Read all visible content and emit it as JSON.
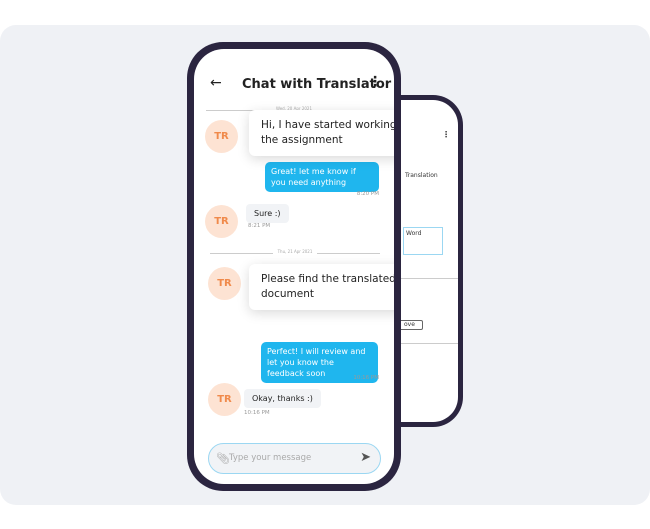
{
  "header": {
    "title": "Chat with Translator"
  },
  "messages": {
    "date1": "Wed, 20 Apr 2021",
    "m1": "Hi, I have started working  on the assignment",
    "m2": "Great! let me know if you need anything",
    "t2": "8:20 PM",
    "m3": "Sure :)",
    "t3": "8:21 PM",
    "date2": "Thu, 21 Apr 2021",
    "m4": "Please find the translated document",
    "m5": "Perfect! I will review and let you know the feedback soon",
    "t5": "10:16 PM",
    "m6": "Okay, thanks :)",
    "t6": "10:16 PM"
  },
  "avatar": "TR",
  "input": {
    "placeholder": "Type your message"
  },
  "back_screen": {
    "label1": "Translation",
    "label2": "Word",
    "button": "ove"
  },
  "colors": {
    "accent": "#1fb6ee",
    "avatar_bg": "#fde3d3",
    "avatar_text": "#f08a4b"
  }
}
